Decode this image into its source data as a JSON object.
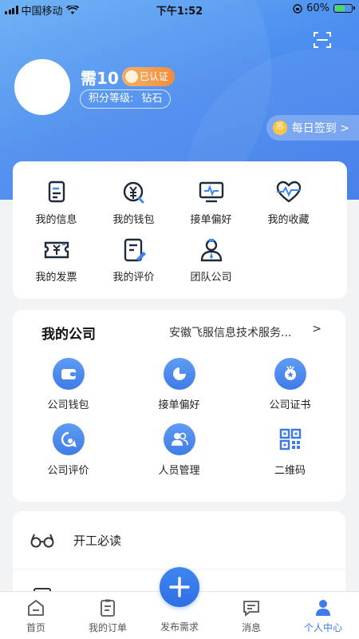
{
  "status": {
    "carrier": "中国移动",
    "time": "下午1:52",
    "battery": "60%",
    "battery_level": 0.6
  },
  "profile": {
    "name": "需10",
    "verified": "已认证",
    "level_label": "积分等级:",
    "level_value": "钻石",
    "checkin": "每日签到 >",
    "coin": "币"
  },
  "services": [
    {
      "label": "我的信息",
      "icon": "document-icon"
    },
    {
      "label": "我的钱包",
      "icon": "wallet-yen-icon"
    },
    {
      "label": "接单偏好",
      "icon": "monitor-icon"
    },
    {
      "label": "我的收藏",
      "icon": "heart-pulse-icon"
    },
    {
      "label": "我的发票",
      "icon": "invoice-icon"
    },
    {
      "label": "我的评价",
      "icon": "review-icon"
    },
    {
      "label": "团队公司",
      "icon": "team-icon"
    }
  ],
  "company": {
    "title": "我的公司",
    "name": "安徽飞服信息技术服务...",
    "arrow": ">",
    "items": [
      {
        "label": "公司钱包",
        "icon": "wallet-icon"
      },
      {
        "label": "接单偏好",
        "icon": "pie-icon"
      },
      {
        "label": "公司证书",
        "icon": "medal-icon"
      },
      {
        "label": "公司评价",
        "icon": "chat-icon"
      },
      {
        "label": "人员管理",
        "icon": "people-icon"
      },
      {
        "label": "二维码",
        "icon": "qrcode-icon"
      }
    ]
  },
  "list": [
    {
      "label": "开工必读",
      "icon": "glasses-icon"
    }
  ],
  "tabbar": {
    "home": "首页",
    "orders": "我的订单",
    "publish": "发布需求",
    "messages": "消息",
    "profile": "个人中心"
  },
  "colors": {
    "primary": "#3f7ae8",
    "badge": "#f08c3c"
  }
}
